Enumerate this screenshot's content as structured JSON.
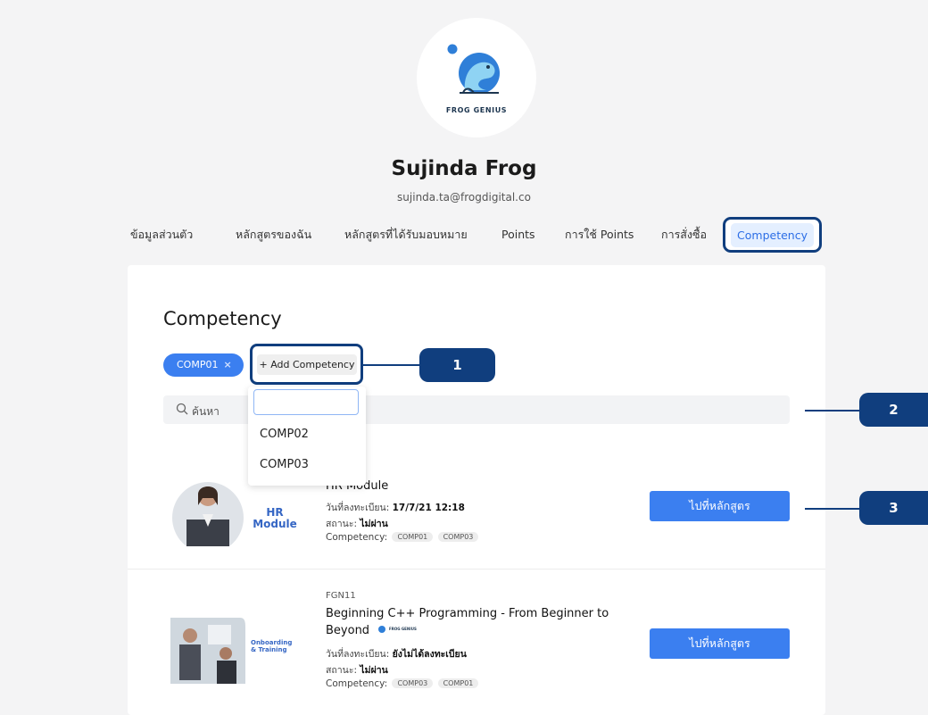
{
  "brand": {
    "name": "FROG GENIUS"
  },
  "profile": {
    "name": "Sujinda Frog",
    "email": "sujinda.ta@frogdigital.co"
  },
  "tabs": [
    {
      "label": "ข้อมูลส่วนตัว"
    },
    {
      "label": "หลักสูตรของฉัน"
    },
    {
      "label": "หลักสูตรที่ได้รับมอบหมาย"
    },
    {
      "label": "Points"
    },
    {
      "label": "การใช้ Points"
    },
    {
      "label": "การสั่งซื้อ"
    },
    {
      "label": "Competency"
    }
  ],
  "competency": {
    "title": "Competency",
    "selected_chip": "COMP01",
    "chip_remove": "×",
    "add_button": "+ Add Competency",
    "search_placeholder": "ค้นหา",
    "dropdown_options": [
      "COMP02",
      "COMP03"
    ]
  },
  "courses": [
    {
      "code": "",
      "title": "HR Module",
      "thumb_label_1": "HR",
      "thumb_label_2": "Module",
      "registered_label": "วันที่ลงทะเบียน:",
      "registered_value": "17/7/21 12:18",
      "status_label": "สถานะ:",
      "status_value": "ไม่ผ่าน",
      "competency_label": "Competency:",
      "tags": [
        "COMP01",
        "COMP03"
      ],
      "button": "ไปที่หลักสูตร"
    },
    {
      "code": "FGN11",
      "title": "Beginning C++ Programming - From Beginner to Beyond",
      "thumb_label_1": "Onboarding",
      "thumb_label_2": "& Training",
      "thumb_brand": "FROG GENIUS",
      "registered_label": "วันที่ลงทะเบียน:",
      "registered_value": "ยังไม่ได้ลงทะเบียน",
      "status_label": "สถานะ:",
      "status_value": "ไม่ผ่าน",
      "competency_label": "Competency:",
      "tags": [
        "COMP03",
        "COMP01"
      ],
      "button": "ไปที่หลักสูตร"
    }
  ],
  "callouts": [
    "1",
    "2",
    "3"
  ],
  "colors": {
    "accent": "#3b7ff0",
    "callout": "#103e7e",
    "background": "#f4f4f5"
  }
}
